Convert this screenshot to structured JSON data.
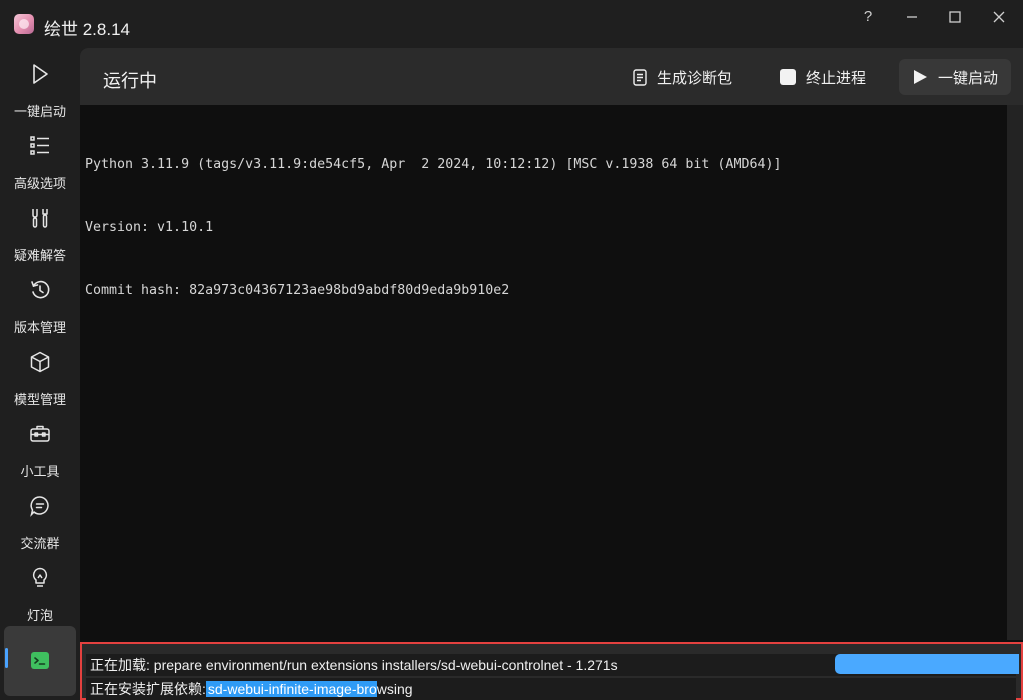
{
  "window": {
    "title": "绘世 2.8.14",
    "help_label": "?",
    "accent": "#4aa3ff"
  },
  "sidebar": {
    "items": [
      {
        "label": "一键启动",
        "icon": "play-icon"
      },
      {
        "label": "高级选项",
        "icon": "list-settings-icon"
      },
      {
        "label": "疑难解答",
        "icon": "tools-icon"
      },
      {
        "label": "版本管理",
        "icon": "history-icon"
      },
      {
        "label": "模型管理",
        "icon": "cube-icon"
      },
      {
        "label": "小工具",
        "icon": "toolbox-icon"
      },
      {
        "label": "交流群",
        "icon": "chat-icon"
      },
      {
        "label": "灯泡",
        "icon": "lightbulb-icon"
      },
      {
        "label": "",
        "icon": "console-icon",
        "active": true
      }
    ]
  },
  "header": {
    "title": "运行中",
    "diag_label": "生成诊断包",
    "stop_label": "终止进程",
    "launch_label": "一键启动"
  },
  "console": {
    "lines": [
      "Python 3.11.9 (tags/v3.11.9:de54cf5, Apr  2 2024, 10:12:12) [MSC v.1938 64 bit (AMD64)]",
      "Version: v1.10.1",
      "Commit hash: 82a973c04367123ae98bd9abdf80d9eda9b910e2"
    ]
  },
  "status": {
    "loading_text": "正在加载: prepare environment/run extensions installers/sd-webui-controlnet - 1.271s",
    "install_prefix": "正在安装扩展依赖: ",
    "install_highlight": "sd-webui-infinite-image-bro",
    "install_rest": "wsing",
    "progress_color": "#4aa9ff",
    "highlight_color": "#2f9bf5",
    "border_color": "#e4413f"
  }
}
